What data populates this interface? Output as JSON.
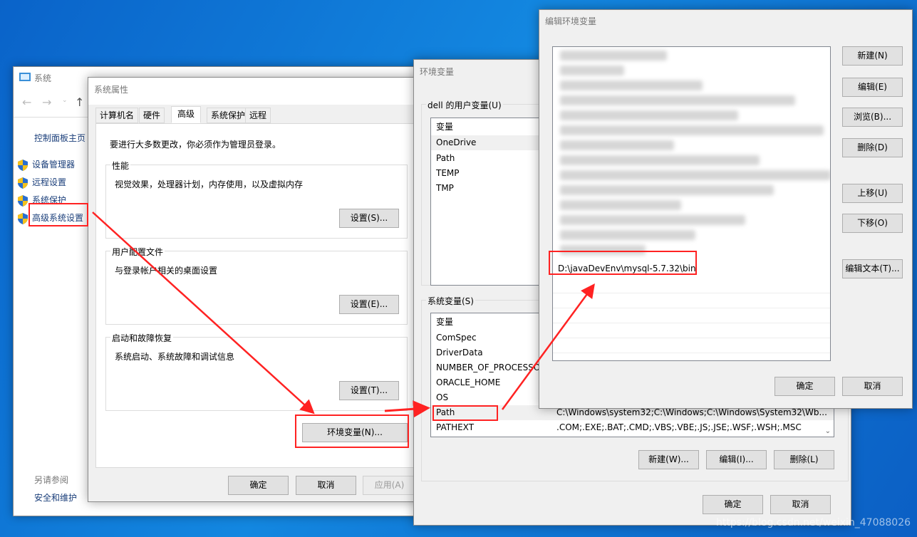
{
  "system_window": {
    "title": "系统",
    "home": "控制面板主页",
    "links": [
      "设备管理器",
      "远程设置",
      "系统保护",
      "高级系统设置"
    ],
    "see_also": "另请参阅",
    "security": "安全和维护"
  },
  "sysprop": {
    "title": "系统属性",
    "tabs": [
      "计算机名",
      "硬件",
      "高级",
      "系统保护",
      "远程"
    ],
    "admin_note": "要进行大多数更改，你必须作为管理员登录。",
    "groups": [
      {
        "label": "性能",
        "desc": "视觉效果，处理器计划，内存使用，以及虚拟内存",
        "button": "设置(S)..."
      },
      {
        "label": "用户配置文件",
        "desc": "与登录帐户相关的桌面设置",
        "button": "设置(E)..."
      },
      {
        "label": "启动和故障恢复",
        "desc": "系统启动、系统故障和调试信息",
        "button": "设置(T)..."
      }
    ],
    "env_button": "环境变量(N)...",
    "ok": "确定",
    "cancel": "取消",
    "apply": "应用(A)"
  },
  "envvars": {
    "title": "环境变量",
    "user_label": "dell 的用户变量(U)",
    "user_header": "变量",
    "user_vars": [
      "OneDrive",
      "Path",
      "TEMP",
      "TMP"
    ],
    "sys_label": "系统变量(S)",
    "sys_header": "变量",
    "sys_vars": [
      {
        "name": "ComSpec",
        "value": ""
      },
      {
        "name": "DriverData",
        "value": ""
      },
      {
        "name": "NUMBER_OF_PROCESSO",
        "value": ""
      },
      {
        "name": "ORACLE_HOME",
        "value": ""
      },
      {
        "name": "OS",
        "value": ""
      },
      {
        "name": "Path",
        "value": "C:\\Windows\\system32;C:\\Windows;C:\\Windows\\System32\\Wb..."
      },
      {
        "name": "PATHEXT",
        "value": ".COM;.EXE;.BAT;.CMD;.VBS;.VBE;.JS;.JSE;.WSF;.WSH;.MSC"
      }
    ],
    "new": "新建(W)...",
    "edit": "编辑(I)...",
    "delete": "删除(L)",
    "ok": "确定",
    "cancel": "取消"
  },
  "editenv": {
    "title": "编辑环境变量",
    "new_entry": "D:\\javaDevEnv\\mysql-5.7.32\\bin",
    "buttons": [
      "新建(N)",
      "编辑(E)",
      "浏览(B)...",
      "删除(D)",
      "上移(U)",
      "下移(O)",
      "编辑文本(T)..."
    ],
    "ok": "确定",
    "cancel": "取消"
  },
  "watermark": "https://blog.csdn.net/weixin_47088026",
  "colors": {
    "annotation": "#ff2222",
    "selected_row": "#e5f3ff"
  }
}
